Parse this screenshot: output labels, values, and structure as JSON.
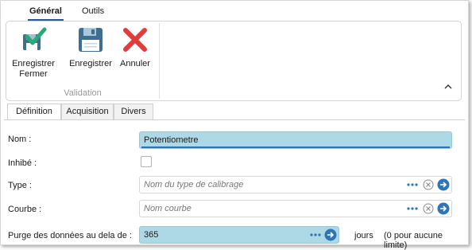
{
  "ribbon": {
    "tabs": [
      "Général",
      "Outils"
    ],
    "group_label": "Validation",
    "buttons": {
      "save_close": {
        "line1": "Enregistrer",
        "line2": "Fermer",
        "icon": "save-close-icon"
      },
      "save": {
        "label": "Enregistrer",
        "icon": "floppy-disk-icon"
      },
      "cancel": {
        "label": "Annuler",
        "icon": "red-x-icon"
      }
    },
    "collapse_icon": "chevron-up-icon"
  },
  "tabs": [
    "Définition",
    "Acquisition",
    "Divers"
  ],
  "form": {
    "name": {
      "label": "Nom :",
      "value": "Potentiometre"
    },
    "inhibit": {
      "label": "Inhibé :",
      "checked": false
    },
    "type": {
      "label": "Type :",
      "placeholder": "Nom du type de calibrage"
    },
    "curve": {
      "label": "Courbe :",
      "placeholder": "Nom courbe"
    },
    "purge": {
      "label": "Purge des données au dela de :",
      "value": "365",
      "unit": "jours",
      "hint": "(0 pour aucune limite)"
    }
  },
  "colors": {
    "accent": "#2e75b6",
    "field_filled": "#add8e6",
    "cancel_red": "#e03c3c",
    "check_green": "#2aa876"
  }
}
